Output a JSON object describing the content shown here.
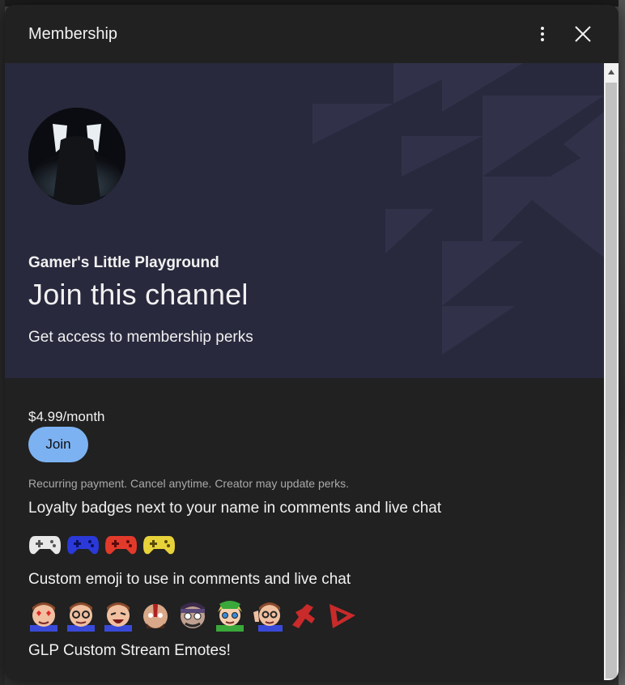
{
  "dialog": {
    "title": "Membership",
    "more_icon": "more-vertical-icon",
    "close_icon": "close-icon"
  },
  "hero": {
    "channel_name": "Gamer's Little Playground",
    "heading": "Join this channel",
    "subheading": "Get access to membership perks"
  },
  "plan": {
    "price": "$4.99/month",
    "join_label": "Join",
    "fine_print": "Recurring payment. Cancel anytime. Creator may update perks."
  },
  "perks": [
    {
      "title": "Loyalty badges next to your name in comments and live chat"
    },
    {
      "title": "Custom emoji to use in comments and live chat"
    },
    {
      "title": "GLP Custom Stream Emotes!"
    }
  ],
  "badges": [
    {
      "icon": "gamepad-badge-icon",
      "color": "#e8e8e8"
    },
    {
      "icon": "gamepad-badge-icon",
      "color": "#2a39d8"
    },
    {
      "icon": "gamepad-badge-icon",
      "color": "#e23a2a"
    },
    {
      "icon": "gamepad-badge-icon",
      "color": "#e8d23a"
    }
  ],
  "emojis": [
    {
      "icon": "heart-eyes-emoji-icon",
      "color": "#b5603a"
    },
    {
      "icon": "glasses-face-emoji-icon",
      "color": "#b5603a"
    },
    {
      "icon": "laughing-face-emoji-icon",
      "color": "#b5603a"
    },
    {
      "icon": "warrior-face-emoji-icon",
      "color": "#d8a070"
    },
    {
      "icon": "masked-face-emoji-icon",
      "color": "#5a4a6a"
    },
    {
      "icon": "elf-face-emoji-icon",
      "color": "#e8d860"
    },
    {
      "icon": "waving-face-emoji-icon",
      "color": "#b5603a"
    },
    {
      "icon": "red-logo-emoji-icon",
      "color": "#c92a2a"
    },
    {
      "icon": "play-logo-emoji-icon",
      "color": "#c92a2a"
    }
  ],
  "colors": {
    "dialog_bg": "#212121",
    "hero_bg": "#28293d",
    "join_button": "#7cb2f2"
  }
}
